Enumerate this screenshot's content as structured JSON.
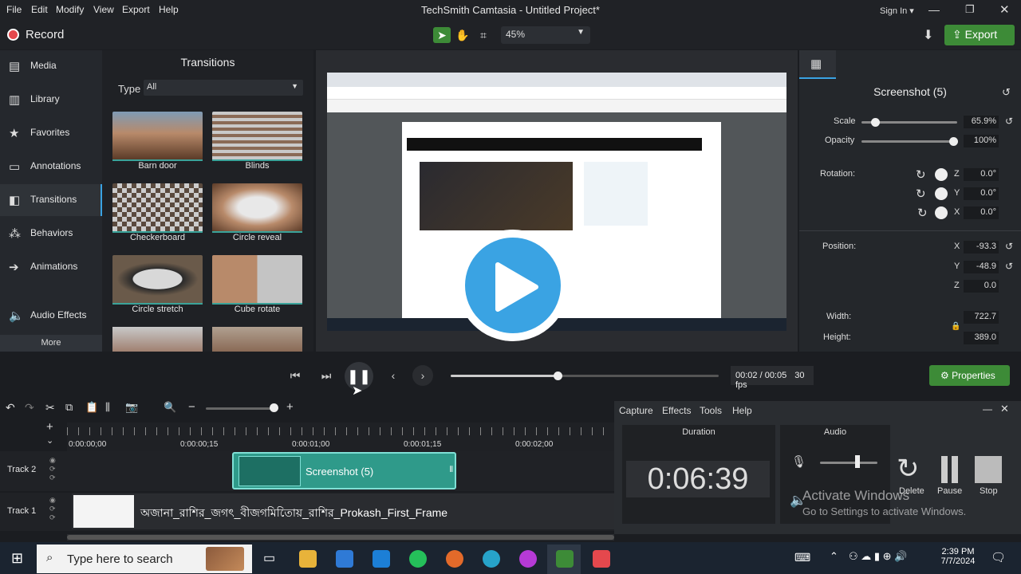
{
  "menu": [
    "File",
    "Edit",
    "Modify",
    "View",
    "Export",
    "Help"
  ],
  "window_title": "TechSmith Camtasia - Untitled Project*",
  "sign_in": "Sign In ▾",
  "record_label": "Record",
  "zoom_value": "45%",
  "export_label": "Export",
  "sidebar": {
    "items": [
      {
        "label": "Media",
        "icon": "media-icon"
      },
      {
        "label": "Library",
        "icon": "library-icon"
      },
      {
        "label": "Favorites",
        "icon": "star-icon"
      },
      {
        "label": "Annotations",
        "icon": "annotation-icon"
      },
      {
        "label": "Transitions",
        "icon": "transition-icon"
      },
      {
        "label": "Behaviors",
        "icon": "behaviors-icon"
      },
      {
        "label": "Animations",
        "icon": "animations-icon"
      },
      {
        "label": "Audio Effects",
        "icon": "speaker-icon"
      }
    ],
    "more": "More"
  },
  "transitions": {
    "title": "Transitions",
    "type_label": "Type",
    "type_value": "All",
    "items": [
      "Barn door",
      "Blinds",
      "Checkerboard",
      "Circle reveal",
      "Circle stretch",
      "Cube rotate"
    ]
  },
  "properties": {
    "title": "Screenshot (5)",
    "scale_label": "Scale",
    "scale_value": "65.9%",
    "scale_level": 0.659,
    "opacity_label": "Opacity",
    "opacity_value": "100%",
    "opacity_level": 1.0,
    "rotation_label": "Rotation:",
    "rotation": {
      "z": "0.0°",
      "y": "0.0°",
      "x": "0.0°"
    },
    "position_label": "Position:",
    "position": {
      "x": "-93.3",
      "y": "-48.9",
      "z": "0.0"
    },
    "width_label": "Width:",
    "width_value": "722.7",
    "height_label": "Height:",
    "height_value": "389.0",
    "axis": {
      "x": "X",
      "y": "Y",
      "z": "Z"
    }
  },
  "playback": {
    "time": "00:02 / 00:05",
    "fps": "30 fps",
    "properties_label": "Properties",
    "progress": 0.4
  },
  "timeline": {
    "ticks": [
      "0:00:00;00",
      "0:00:00;15",
      "0:00:01;00",
      "0:00:01;15",
      "0:00:02;00"
    ],
    "track2_label": "Track 2",
    "track1_label": "Track 1",
    "clip2_label": "Screenshot (5)",
    "clip1_label": "অজানা_রাশির_জগৎ_বীজগমিতোিয়_রাশির_Prokash_First_Frame"
  },
  "recorder": {
    "menu": [
      "Capture",
      "Effects",
      "Tools",
      "Help"
    ],
    "duration_label": "Duration",
    "duration": "0:06:39",
    "audio_label": "Audio",
    "delete_label": "Delete",
    "pause_label": "Pause",
    "stop_label": "Stop"
  },
  "watermark": {
    "line1": "Activate Windows",
    "line2": "Go to Settings to activate Windows."
  },
  "taskbar": {
    "search_placeholder": "Type here to search",
    "time": "2:39 PM",
    "date": "7/7/2024"
  },
  "colors": {
    "accent_green": "#3d8b37",
    "accent_blue": "#3aa3e3",
    "record_red": "#e5484d",
    "clip_teal": "#2f9a8a"
  }
}
